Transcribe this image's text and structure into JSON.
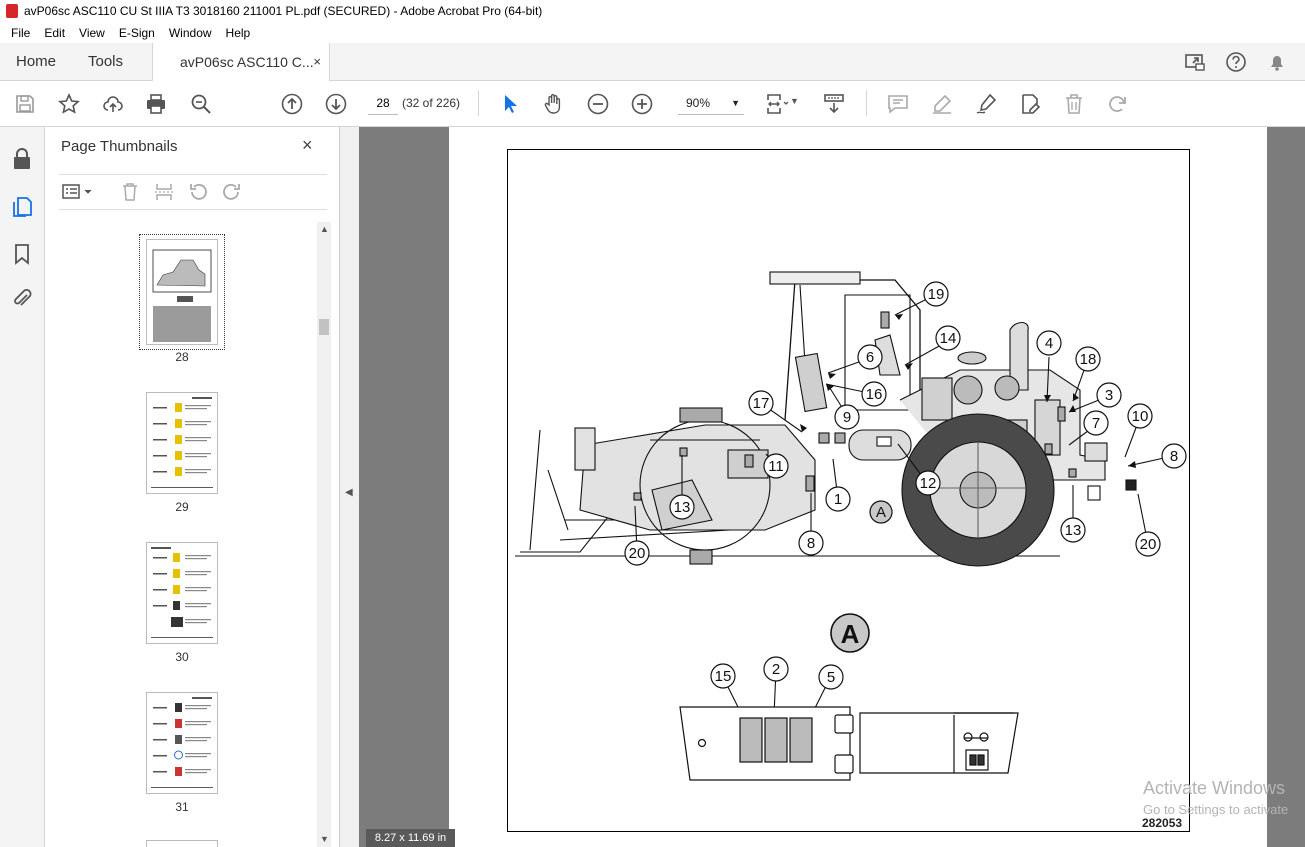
{
  "window": {
    "title": "avP06sc ASC110 CU St IIIA T3 3018160 211001 PL.pdf (SECURED) - Adobe Acrobat Pro (64-bit)"
  },
  "menu": [
    "File",
    "Edit",
    "View",
    "E-Sign",
    "Window",
    "Help"
  ],
  "tabs": {
    "home": "Home",
    "tools": "Tools",
    "document": "avP06sc ASC110 C...",
    "close": "×"
  },
  "toolbar": {
    "page_number": "28",
    "page_count": "(32 of 226)",
    "zoom": "90%"
  },
  "thumbnails": {
    "title": "Page Thumbnails",
    "close": "×",
    "pages": [
      "28",
      "29",
      "30",
      "31"
    ],
    "selected": "28"
  },
  "status": {
    "page_size": "8.27 x 11.69 in"
  },
  "figure": {
    "number": "282053",
    "view_label": "A",
    "callouts": [
      "19",
      "14",
      "6",
      "16",
      "4",
      "18",
      "3",
      "7",
      "10",
      "8",
      "17",
      "9",
      "11",
      "12",
      "1",
      "A",
      "13",
      "20",
      "8",
      "13",
      "20",
      "15",
      "2",
      "5"
    ]
  },
  "watermark": {
    "line1": "Activate Windows",
    "line2": "Go to Settings to activate"
  },
  "colors": {
    "accent": "#1473e6",
    "canvas": "#7c7c7c",
    "panel": "#f4f4f4"
  }
}
